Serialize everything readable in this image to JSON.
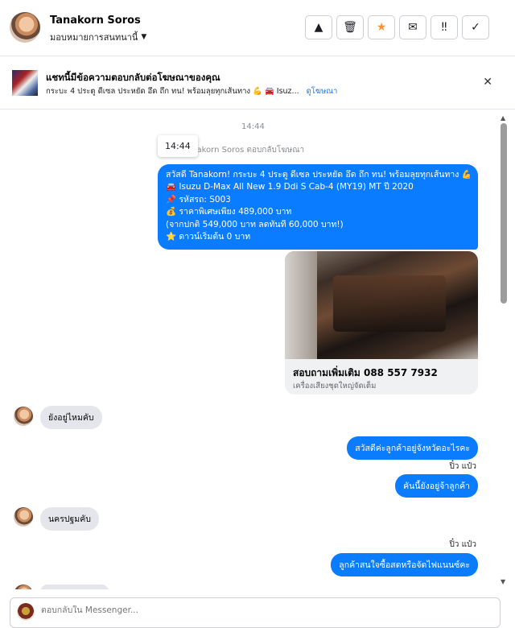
{
  "header": {
    "contact_name": "Tanakorn Soros",
    "assign_label": "มอบหมายการสนทนานี้",
    "actions": [
      {
        "icon": "warning-icon",
        "glyph": "▲"
      },
      {
        "icon": "trash-icon",
        "glyph": "🗑"
      },
      {
        "icon": "star-icon",
        "glyph": "★"
      },
      {
        "icon": "envelope-icon",
        "glyph": "✉"
      },
      {
        "icon": "important-icon",
        "glyph": "‼"
      },
      {
        "icon": "check-icon",
        "glyph": "✓"
      }
    ]
  },
  "banner": {
    "title": "แชทนี้มีข้อความตอบกลับต่อโฆษณาของคุณ",
    "subtitle": "กระบะ 4 ประตู ดีเซล ประหยัด อึด ถึก ทน! พร้อมลุยทุกเส้นทาง 💪 🚘 Isuz...",
    "link": "ดูโฆษณา"
  },
  "thread": {
    "timestamp": "14:44",
    "tooltip": "14:44",
    "replied_note": "anakorn Soros ตอบกลับโฆษณา",
    "ad_message_lines": [
      "สวัสดี Tanakorn! กระบะ 4 ประตู ดีเซล ประหยัด อึด ถึก ทน! พร้อมลุยทุกเส้นทาง 💪",
      "🚘 Isuzu D-Max All New 1.9 Ddi S Cab-4 (MY19) MT ปี 2020",
      "📌 รหัสรถ: S003",
      "💰 ราคาพิเศษเพียง 489,000 บาท",
      "(จากปกติ 549,000 บาท ลดทันที 60,000 บาท!)",
      "⭐ ดาวน์เริ่มต้น 0 บาท"
    ],
    "card": {
      "title": "สอบถามเพิ่มเติม 088 557 7932",
      "subtitle": "เครื่องเสียงชุดใหญ่จัดเต็ม"
    },
    "incoming_1": "ยังอยู่ไหมคับ",
    "outgoing_1": "สวัสดีค่ะลูกค้าอยู่จังหวัดอะไรคะ",
    "sender_1": "ปิ๋ว แป๋ว",
    "outgoing_2": "คันนี้ยังอยู่จ้าลูกค้า",
    "incoming_2": "นครปฐมคับ",
    "sender_2": "ปิ๋ว แป๋ว",
    "outgoing_3": "ลูกค้าสนใจซื้อสดหรือจัดไฟแนนซ์คะ"
  },
  "composer": {
    "placeholder": "ตอบกลับใน Messenger..."
  }
}
